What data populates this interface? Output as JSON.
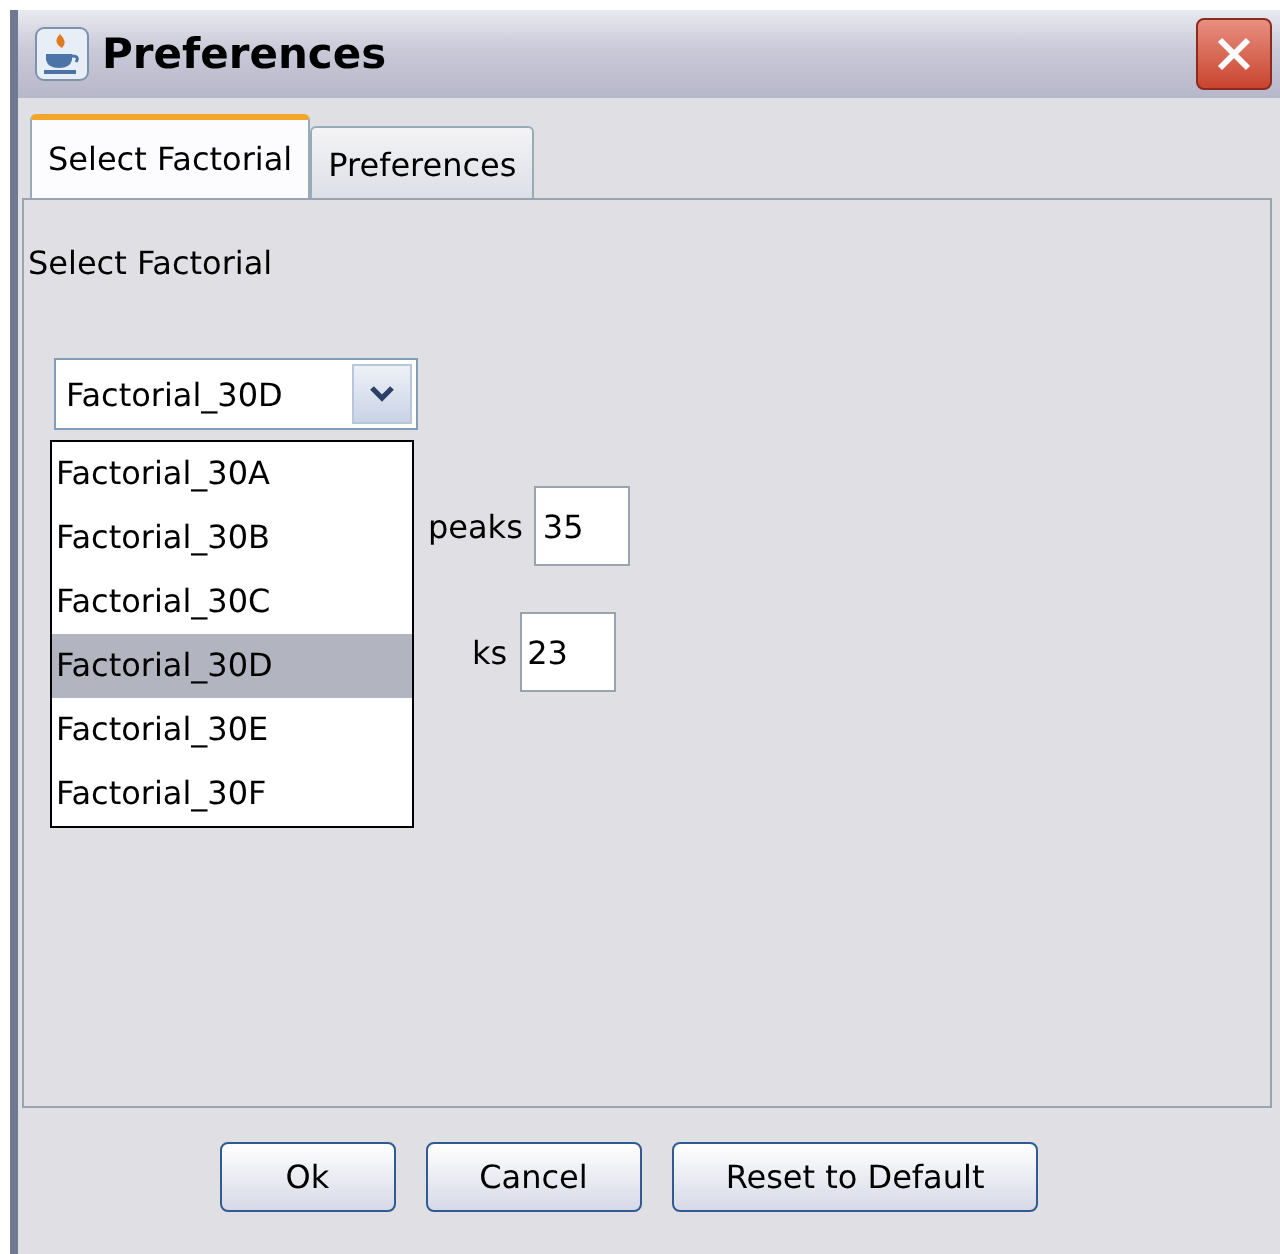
{
  "window": {
    "title": "Preferences"
  },
  "tabs": [
    {
      "label": "Select Factorial",
      "selected": true
    },
    {
      "label": "Preferences",
      "selected": false
    }
  ],
  "panel": {
    "heading": "Select Factorial",
    "combo": {
      "value": "Factorial_30D",
      "expanded": true,
      "options": [
        {
          "label": "Factorial_30A",
          "selected": false
        },
        {
          "label": "Factorial_30B",
          "selected": false
        },
        {
          "label": "Factorial_30C",
          "selected": false
        },
        {
          "label": "Factorial_30D",
          "selected": true
        },
        {
          "label": "Factorial_30E",
          "selected": false
        },
        {
          "label": "Factorial_30F",
          "selected": false
        }
      ]
    },
    "fields": [
      {
        "label": "peaks",
        "value": "35"
      },
      {
        "label": "ks",
        "value": "23"
      }
    ]
  },
  "buttons": [
    "Ok",
    "Cancel",
    "Reset to Default"
  ]
}
